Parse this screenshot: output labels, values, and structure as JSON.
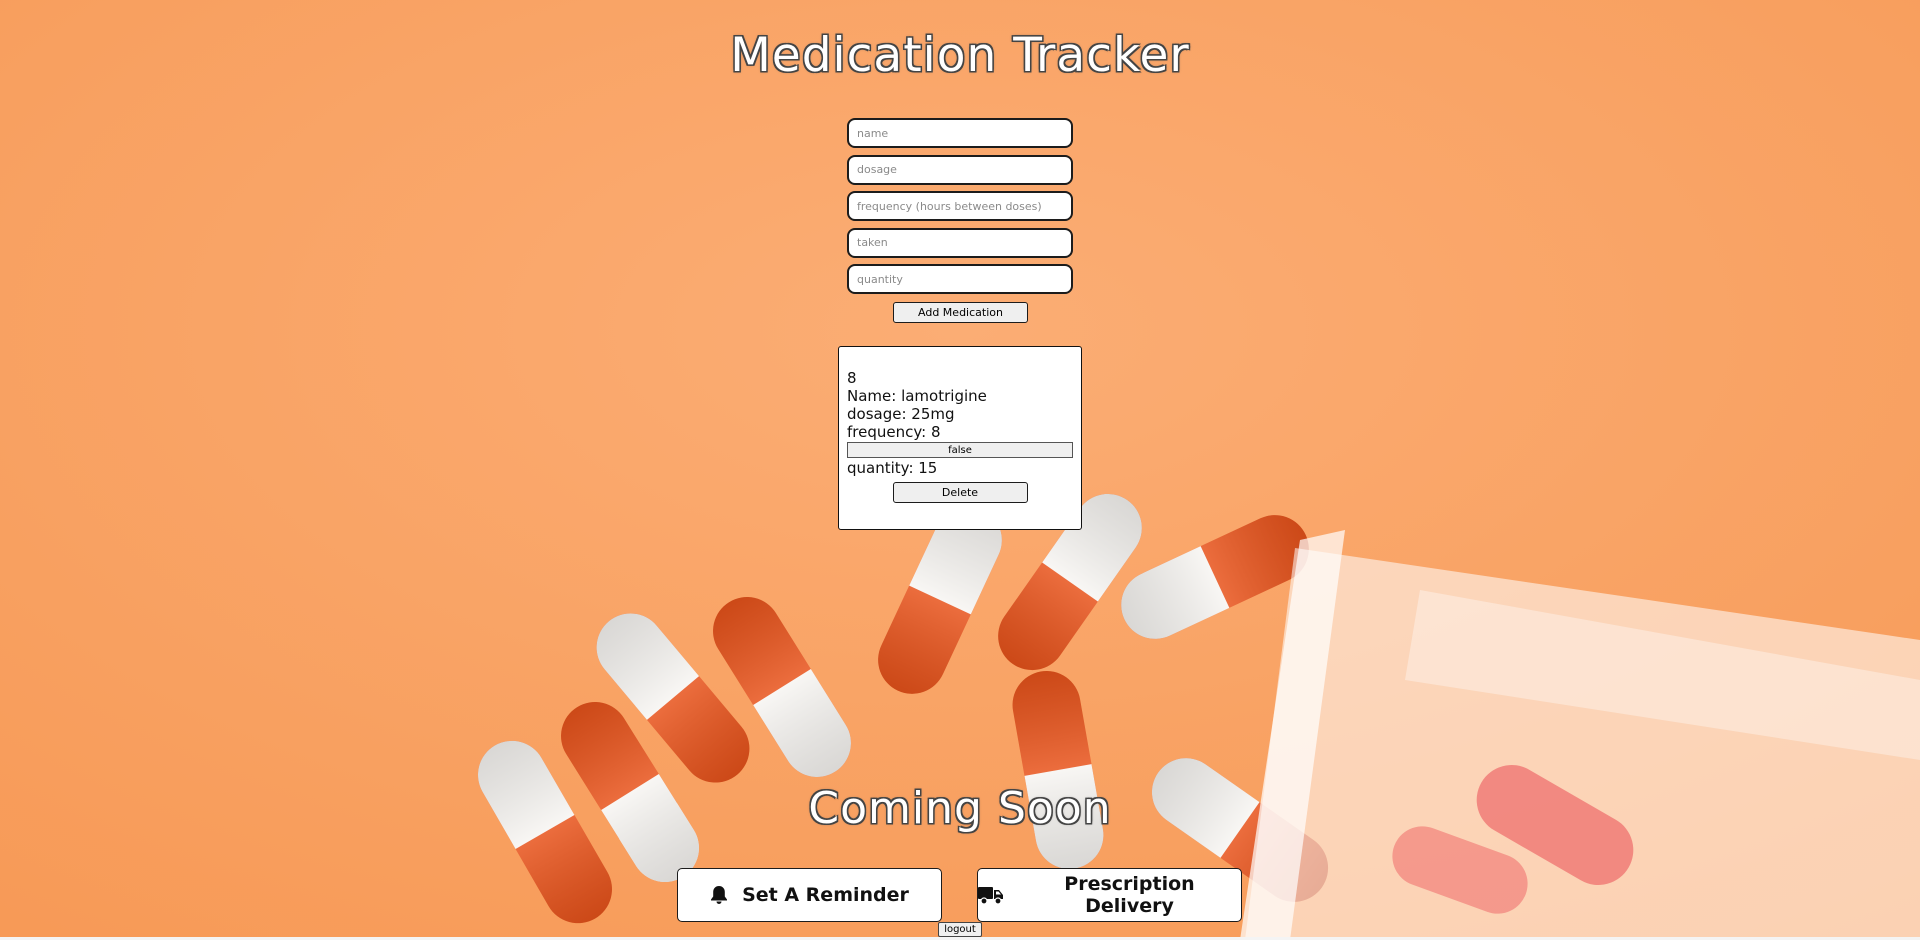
{
  "app": {
    "title": "Medication Tracker"
  },
  "form": {
    "name_placeholder": "name",
    "dosage_placeholder": "dosage",
    "frequency_placeholder": "frequency (hours between doses)",
    "taken_placeholder": "taken",
    "quantity_placeholder": "quantity",
    "add_button_label": "Add Medication"
  },
  "medications": [
    {
      "id": "8",
      "name_line": "Name: lamotrigine",
      "dosage_line": "dosage: 25mg",
      "frequency_line": "frequency: 8",
      "taken_label": "false",
      "quantity_line": "quantity: 15",
      "delete_label": "Delete"
    }
  ],
  "coming_soon": {
    "heading": "Coming Soon",
    "reminder_label": "Set A Reminder",
    "delivery_label": "Prescription Delivery"
  },
  "logout_label": "logout",
  "icons": {
    "reminder": "bell-icon",
    "delivery": "truck-icon"
  },
  "colors": {
    "background": "#f9a262",
    "capsule_orange": "#e8531b",
    "capsule_white": "#f7f5f2"
  }
}
